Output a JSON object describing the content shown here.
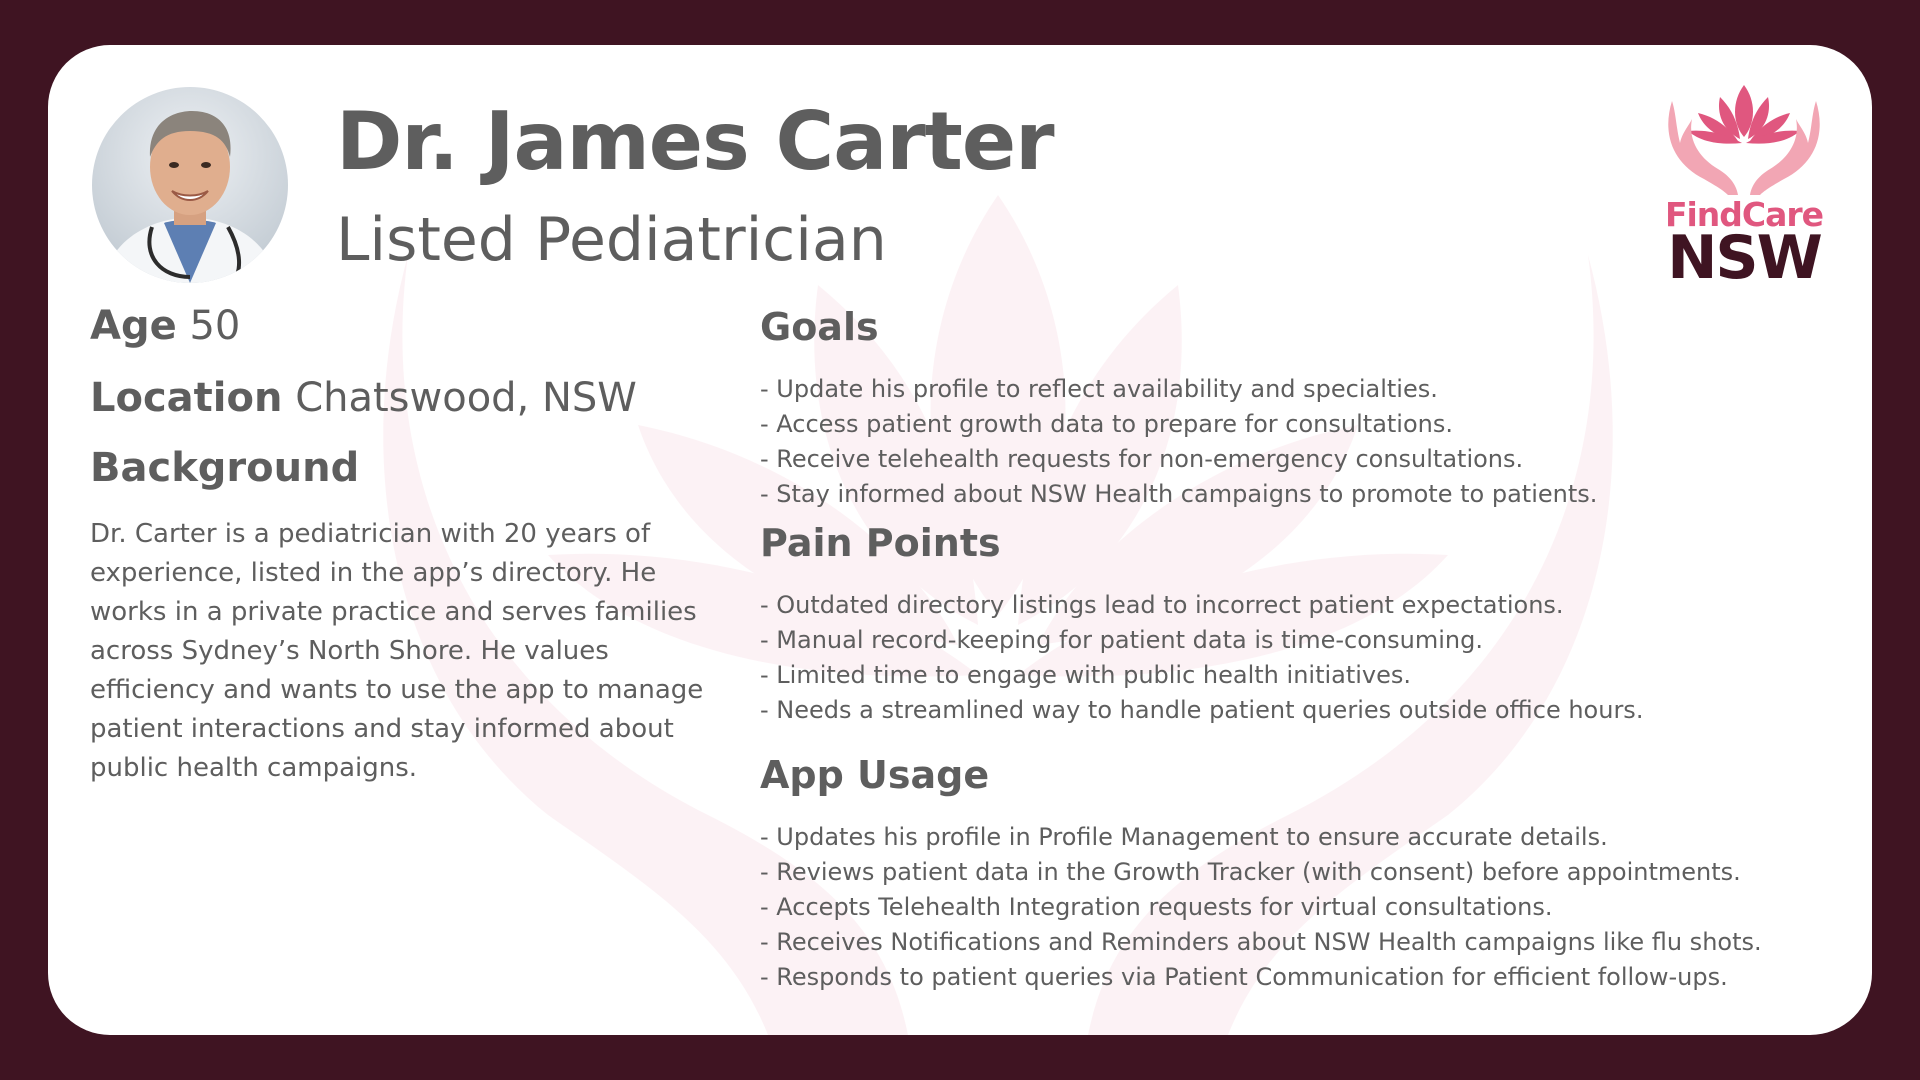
{
  "persona": {
    "name": "Dr. James Carter",
    "role": "Listed Pediatrician"
  },
  "logo": {
    "line1": "FindCare",
    "line2": "NSW"
  },
  "details": {
    "age_label": "Age",
    "age_value": "50",
    "location_label": "Location",
    "location_value": "Chatswood, NSW"
  },
  "background": {
    "title": "Background",
    "text": "Dr. Carter is a pediatrician with 20 years of experience, listed in the app’s directory. He works in a private practice and serves families across Sydney’s North Shore. He values efficiency and wants to use the app to manage patient interactions and stay informed about public health campaigns."
  },
  "goals": {
    "title": "Goals",
    "items": [
      "- Update his profile to reflect availability and specialties.",
      "- Access patient growth data to prepare for consultations.",
      "- Receive telehealth requests for non-emergency consultations.",
      "- Stay informed about NSW Health campaigns to promote to patients."
    ]
  },
  "pain_points": {
    "title": "Pain Points",
    "items": [
      "- Outdated directory listings lead to incorrect patient expectations.",
      "- Manual record-keeping for patient data is time-consuming.",
      "- Limited time to engage with public health initiatives.",
      "- Needs a streamlined way to handle patient queries outside office hours."
    ]
  },
  "app_usage": {
    "title": "App Usage",
    "items": [
      "- Updates his profile in Profile Management to ensure accurate details.",
      "- Reviews patient data in the Growth Tracker (with consent) before appointments.",
      "- Accepts Telehealth Integration requests for virtual consultations.",
      "- Receives Notifications and Reminders about NSW Health campaigns like flu shots.",
      "- Responds to patient queries via Patient Communication for efficient follow-ups."
    ]
  },
  "colors": {
    "frame": "#3f1422",
    "card": "#ffffff",
    "text": "#5e5e5e",
    "brand_pink": "#e0577f",
    "hand_pink": "#f2a6b4",
    "brand_dark": "#3f1422"
  }
}
